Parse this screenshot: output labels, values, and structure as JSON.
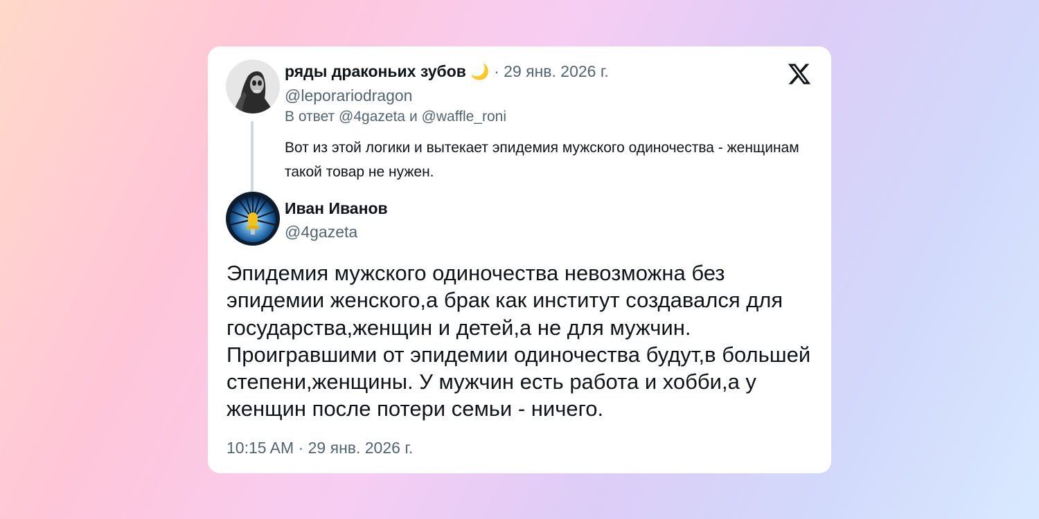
{
  "card": {
    "parent_tweet": {
      "display_name": "ряды драконьих зубов",
      "name_emoji": "🌙",
      "separator": "·",
      "date": "29 янв. 2026 г.",
      "handle": "@leporariodragon",
      "reply_to_prefix": "В ответ",
      "reply_to_user1": "@4gazeta",
      "reply_to_conj": "и",
      "reply_to_user2": "@waffle_roni",
      "text": "Вот из этой логики и вытекает эпидемия мужского одиночества - женщинам такой товар не нужен."
    },
    "main_tweet": {
      "display_name": "Иван Иванов",
      "handle": "@4gazeta",
      "text": "Эпидемия мужского одиночества невозможна без эпидемии женского,а брак как институт создавался для государства,женщин и детей,а не для мужчин. Проигравшими от эпидемии одиночества будут,в большей степени,женщины. У мужчин есть работа и хобби,а у женщин после потери семьи - ничего.",
      "time": "10:15 AM",
      "separator": "·",
      "date": "29 янв. 2026 г."
    },
    "platform_icon": "x-logo-icon"
  },
  "colors": {
    "text_primary": "#0f1419",
    "text_secondary": "#536471",
    "thread_line": "#cfd9de",
    "card_bg": "#ffffff"
  }
}
